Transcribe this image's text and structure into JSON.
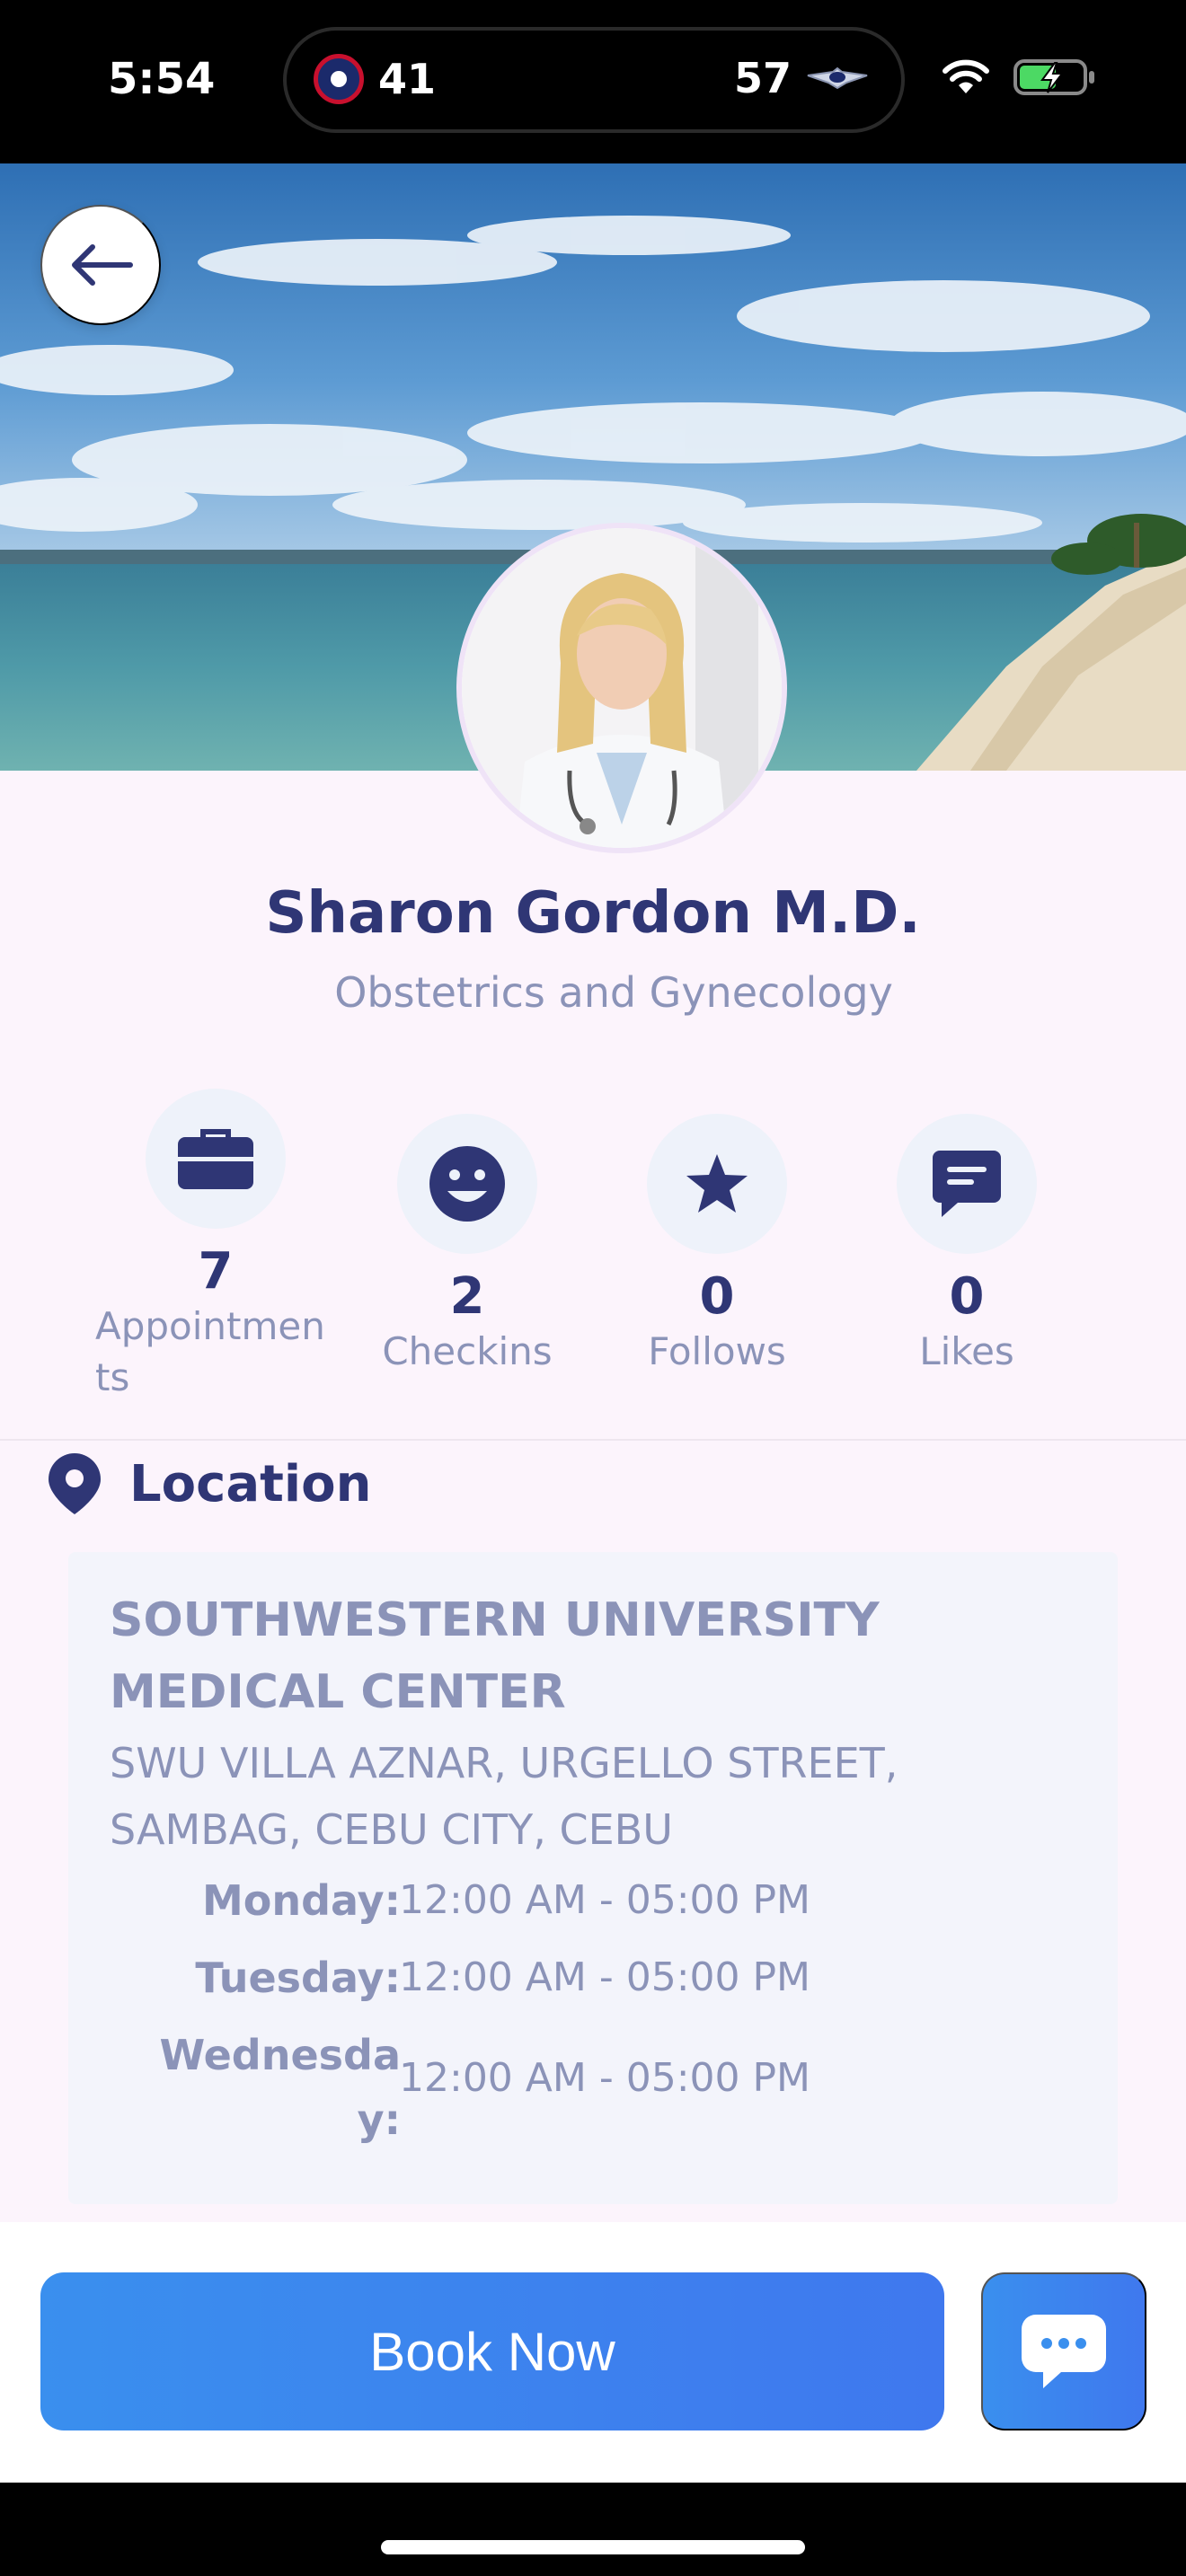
{
  "status_bar": {
    "time": "5:54",
    "score_left": "41",
    "score_right": "57"
  },
  "profile": {
    "name": "Sharon Gordon M.D.",
    "specialty": "Obstetrics and Gynecology"
  },
  "stats": [
    {
      "icon": "briefcase-icon",
      "value": "7",
      "label": "Appointmen ts"
    },
    {
      "icon": "smiley-icon",
      "value": "2",
      "label": "Checkins"
    },
    {
      "icon": "star-icon",
      "value": "0",
      "label": "Follows"
    },
    {
      "icon": "message-icon",
      "value": "0",
      "label": "Likes"
    }
  ],
  "location": {
    "title": "Location",
    "hospital": "SOUTHWESTERN UNIVERSITY MEDICAL CENTER",
    "address": "SWU VILLA AZNAR, URGELLO STREET, SAMBAG, CEBU CITY, CEBU",
    "hours": [
      {
        "day": "Monday:",
        "time": "12:00 AM - 05:00 PM"
      },
      {
        "day": "Tuesday:",
        "time": "12:00 AM - 05:00 PM"
      },
      {
        "day": "Wednesda y:",
        "time": "12:00 AM - 05:00 PM"
      }
    ]
  },
  "actions": {
    "book_label": "Book Now"
  },
  "colors": {
    "primary": "#2f3675",
    "muted": "#8b93b8",
    "button": "#3a8fee",
    "background": "#fcf4fc"
  }
}
